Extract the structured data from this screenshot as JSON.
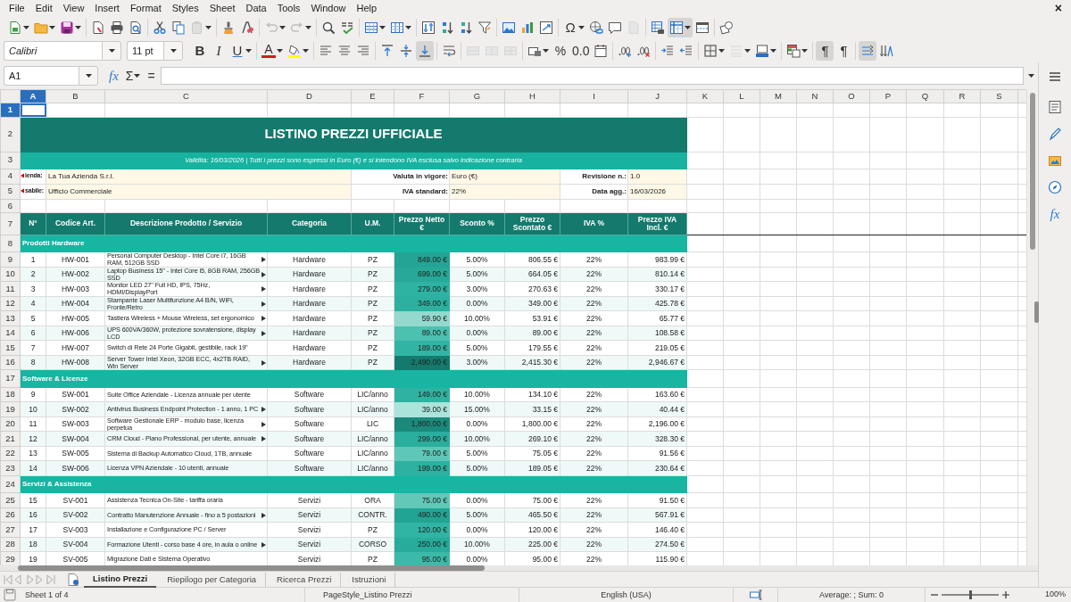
{
  "menu": [
    "File",
    "Edit",
    "View",
    "Insert",
    "Format",
    "Styles",
    "Sheet",
    "Data",
    "Tools",
    "Window",
    "Help"
  ],
  "close_document": "×",
  "standard_toolbar": [
    [
      {
        "kind": "new",
        "dropdown": true,
        "active": false,
        "disabled": false
      },
      {
        "kind": "open",
        "dropdown": true,
        "active": false,
        "disabled": false
      },
      {
        "kind": "save",
        "dropdown": true,
        "active": false,
        "disabled": false
      }
    ],
    [
      {
        "kind": "pdf",
        "dropdown": false,
        "active": false,
        "disabled": false
      },
      {
        "kind": "print",
        "dropdown": false,
        "active": false,
        "disabled": false
      },
      {
        "kind": "preview",
        "dropdown": false,
        "active": false,
        "disabled": false
      }
    ],
    [
      {
        "kind": "cut",
        "dropdown": false,
        "active": false,
        "disabled": false
      },
      {
        "kind": "copy",
        "dropdown": false,
        "active": false,
        "disabled": false
      },
      {
        "kind": "paste",
        "dropdown": true,
        "active": false,
        "disabled": true
      }
    ],
    [
      {
        "kind": "clone",
        "dropdown": false,
        "active": false,
        "disabled": false
      },
      {
        "kind": "clear",
        "dropdown": false,
        "active": false,
        "disabled": false
      }
    ],
    [
      {
        "kind": "undo",
        "dropdown": true,
        "active": false,
        "disabled": true
      },
      {
        "kind": "redo",
        "dropdown": true,
        "active": false,
        "disabled": true
      }
    ],
    [
      {
        "kind": "find",
        "dropdown": false,
        "active": false,
        "disabled": false
      },
      {
        "kind": "spelling",
        "dropdown": false,
        "active": false,
        "disabled": false
      }
    ],
    [
      {
        "kind": "rows",
        "dropdown": true,
        "active": false,
        "disabled": false
      },
      {
        "kind": "columns",
        "dropdown": true,
        "active": false,
        "disabled": false
      }
    ],
    [
      {
        "kind": "sort",
        "dropdown": false,
        "active": false,
        "disabled": false
      },
      {
        "kind": "sort-asc",
        "dropdown": false,
        "active": false,
        "disabled": false
      },
      {
        "kind": "sort-desc",
        "dropdown": false,
        "active": false,
        "disabled": false
      },
      {
        "kind": "filter",
        "dropdown": false,
        "active": false,
        "disabled": false
      }
    ],
    [
      {
        "kind": "image",
        "dropdown": false,
        "active": false,
        "disabled": false
      },
      {
        "kind": "chart",
        "dropdown": false,
        "active": false,
        "disabled": false
      },
      {
        "kind": "pivot",
        "dropdown": false,
        "active": false,
        "disabled": false
      }
    ],
    [
      {
        "kind": "special-character",
        "label": "Ω",
        "dropdown": true,
        "active": false,
        "disabled": false
      },
      {
        "kind": "hyperlink",
        "dropdown": false,
        "active": false,
        "disabled": false
      },
      {
        "kind": "comment",
        "dropdown": false,
        "active": false,
        "disabled": false
      },
      {
        "kind": "header-footer",
        "dropdown": false,
        "active": false,
        "disabled": true
      }
    ],
    [
      {
        "kind": "print-area",
        "dropdown": false,
        "active": false,
        "disabled": false
      },
      {
        "kind": "freeze",
        "dropdown": true,
        "active": true,
        "disabled": false
      },
      {
        "kind": "split",
        "dropdown": false,
        "active": false,
        "disabled": false
      }
    ],
    [
      {
        "kind": "shapes",
        "dropdown": false,
        "active": false,
        "disabled": false
      }
    ]
  ],
  "font_name": {
    "value": "Calibri"
  },
  "font_size": {
    "value": "11 pt"
  },
  "formatting_toolbar": [
    [
      {
        "kind": "bold",
        "label": "B",
        "dropdown": false,
        "active": false,
        "disabled": false
      },
      {
        "kind": "italic",
        "label": "I",
        "dropdown": false,
        "active": false,
        "disabled": false
      },
      {
        "kind": "underline",
        "label": "U",
        "dropdown": true,
        "active": false,
        "disabled": false
      }
    ],
    [
      {
        "kind": "font-color",
        "label": "A",
        "color": "#c9211e",
        "dropdown": true,
        "active": false,
        "disabled": false
      },
      {
        "kind": "highlight",
        "color": "#ffff00",
        "dropdown": true,
        "active": false,
        "disabled": false
      }
    ],
    [
      {
        "kind": "align-left",
        "dropdown": false,
        "active": false,
        "disabled": false
      },
      {
        "kind": "align-center",
        "dropdown": false,
        "active": false,
        "disabled": false
      },
      {
        "kind": "align-right",
        "dropdown": false,
        "active": false,
        "disabled": false
      }
    ],
    [
      {
        "kind": "align-top",
        "dropdown": false,
        "active": false,
        "disabled": false
      },
      {
        "kind": "align-middle",
        "dropdown": false,
        "active": false,
        "disabled": false
      },
      {
        "kind": "align-bottom",
        "dropdown": false,
        "active": true,
        "disabled": false
      }
    ],
    [
      {
        "kind": "wrap",
        "dropdown": false,
        "active": false,
        "disabled": false
      }
    ],
    [
      {
        "kind": "merge-center",
        "dropdown": false,
        "active": false,
        "disabled": true
      },
      {
        "kind": "merge",
        "dropdown": false,
        "active": false,
        "disabled": true
      },
      {
        "kind": "unmerge",
        "dropdown": false,
        "active": false,
        "disabled": true
      }
    ],
    [
      {
        "kind": "currency",
        "dropdown": true,
        "active": false,
        "disabled": false
      },
      {
        "kind": "percent",
        "label": "%",
        "dropdown": false,
        "active": false,
        "disabled": false
      },
      {
        "kind": "number",
        "label": "0.0",
        "dropdown": false,
        "active": false,
        "disabled": false
      },
      {
        "kind": "date",
        "dropdown": false,
        "active": false,
        "disabled": false
      }
    ],
    [
      {
        "kind": "add-decimal",
        "dropdown": false,
        "active": false,
        "disabled": false
      },
      {
        "kind": "delete-decimal",
        "dropdown": false,
        "active": false,
        "disabled": false
      }
    ],
    [
      {
        "kind": "indent",
        "dropdown": false,
        "active": false,
        "disabled": false
      },
      {
        "kind": "outdent",
        "dropdown": false,
        "active": false,
        "disabled": false
      }
    ],
    [
      {
        "kind": "borders",
        "dropdown": true,
        "active": false,
        "disabled": false
      },
      {
        "kind": "border-style",
        "dropdown": true,
        "active": false,
        "disabled": true
      },
      {
        "kind": "border-color",
        "dropdown": true,
        "active": false,
        "disabled": false
      }
    ],
    [
      {
        "kind": "conditional",
        "dropdown": true,
        "active": false,
        "disabled": false
      }
    ],
    [
      {
        "kind": "ltr",
        "label": "¶",
        "dropdown": false,
        "active": true,
        "disabled": false
      },
      {
        "kind": "rtl",
        "label": "¶",
        "dropdown": false,
        "active": false,
        "disabled": false
      }
    ],
    [
      {
        "kind": "text-direction",
        "dropdown": false,
        "active": true,
        "disabled": false
      },
      {
        "kind": "vertical-text",
        "dropdown": false,
        "active": false,
        "disabled": false
      }
    ]
  ],
  "formula_bar": {
    "name_box": "A1",
    "function_wizard": "fx",
    "sum": "Σ",
    "equals": "="
  },
  "sheet": {
    "columns": [
      {
        "label": "A",
        "selected": true
      },
      {
        "label": "B",
        "selected": false
      },
      {
        "label": "C",
        "selected": false
      },
      {
        "label": "D",
        "selected": false
      },
      {
        "label": "E",
        "selected": false
      },
      {
        "label": "F",
        "selected": false
      },
      {
        "label": "G",
        "selected": false
      },
      {
        "label": "H",
        "selected": false
      },
      {
        "label": "I",
        "selected": false
      },
      {
        "label": "J",
        "selected": false
      },
      {
        "label": "K",
        "selected": false
      },
      {
        "label": "L",
        "selected": false
      },
      {
        "label": "M",
        "selected": false
      },
      {
        "label": "N",
        "selected": false
      },
      {
        "label": "O",
        "selected": false
      },
      {
        "label": "P",
        "selected": false
      },
      {
        "label": "Q",
        "selected": false
      },
      {
        "label": "R",
        "selected": false
      },
      {
        "label": "S",
        "selected": false
      }
    ],
    "rows": [
      {
        "number": "1",
        "selected": true,
        "kind": "blank"
      },
      {
        "number": "2",
        "selected": false,
        "kind": "title",
        "text": "LISTINO PREZZI UFFICIALE"
      },
      {
        "number": "3",
        "selected": false,
        "kind": "subtitle",
        "text": "Validità: 16/03/2026  |  Tutti i prezzi sono espressi in Euro (€) e si intendono IVA esclusa salvo indicazione contraria"
      },
      {
        "number": "4",
        "selected": false,
        "kind": "info",
        "cells": [
          {
            "label": "ienda:",
            "overflow": true,
            "value": "La Tua Azienda S.r.l."
          },
          {
            "label": "Valuta in vigore:",
            "overflow": false,
            "value": "Euro (€)"
          },
          {
            "label": "Revisione n.:",
            "overflow": false,
            "value": "1.0"
          }
        ]
      },
      {
        "number": "5",
        "selected": false,
        "kind": "info",
        "cells": [
          {
            "label": "sabile:",
            "overflow": true,
            "value": "Ufficio Commerciale"
          },
          {
            "label": "IVA standard:",
            "overflow": false,
            "value": "22%"
          },
          {
            "label": "Data agg.:",
            "overflow": false,
            "value": "16/03/2026"
          }
        ]
      },
      {
        "number": "6",
        "selected": false,
        "kind": "blank"
      },
      {
        "number": "7",
        "selected": false,
        "kind": "header",
        "cells": [
          "N°",
          "Codice Art.",
          "Descrizione Prodotto / Servizio",
          "Categoria",
          "U.M.",
          "Prezzo Netto €",
          "Sconto %",
          "Prezzo Scontato €",
          "IVA %",
          "Prezzo IVA Incl. €"
        ]
      },
      {
        "number": "8",
        "selected": false,
        "kind": "section",
        "text": "Prodotti Hardware"
      },
      {
        "number": "9",
        "selected": false,
        "kind": "item",
        "n": "1",
        "code": "HW-001",
        "description": "Personal Computer Desktop - Intel Core i7, 16GB RAM, 512GB SSD",
        "overflow": true,
        "category": "Hardware",
        "unit": "PZ",
        "net": "849.00 €",
        "color": "#24a494",
        "discount": "5.00%",
        "discounted": "806.55 €",
        "vat": "22%",
        "gross": "983.99 €"
      },
      {
        "number": "10",
        "selected": false,
        "kind": "item",
        "n": "2",
        "code": "HW-002",
        "description": "Laptop Business 15\" - Intel Core i5, 8GB RAM, 256GB SSD",
        "overflow": true,
        "category": "Hardware",
        "unit": "PZ",
        "net": "699.00 €",
        "color": "#27a898",
        "discount": "5.00%",
        "discounted": "664.05 €",
        "vat": "22%",
        "gross": "810.14 €"
      },
      {
        "number": "11",
        "selected": false,
        "kind": "item",
        "n": "3",
        "code": "HW-003",
        "description": "Monitor LED 27\" Full HD, IPS, 75Hz, HDMI/DisplayPort",
        "overflow": true,
        "category": "Hardware",
        "unit": "PZ",
        "net": "279.00 €",
        "color": "#2eb2a1",
        "discount": "3.00%",
        "discounted": "270.63 €",
        "vat": "22%",
        "gross": "330.17 €"
      },
      {
        "number": "12",
        "selected": false,
        "kind": "item",
        "n": "4",
        "code": "HW-004",
        "description": "Stampante Laser Multifunzione A4 B/N, WiFi, Fronte/Retro",
        "overflow": true,
        "category": "Hardware",
        "unit": "PZ",
        "net": "349.00 €",
        "color": "#2cb09f",
        "discount": "0.00%",
        "discounted": "349.00 €",
        "vat": "22%",
        "gross": "425.78 €"
      },
      {
        "number": "13",
        "selected": false,
        "kind": "item",
        "n": "5",
        "code": "HW-005",
        "description": "Tastiera Wireless + Mouse Wireless, set ergonomico",
        "overflow": true,
        "category": "Hardware",
        "unit": "PZ",
        "net": "59.90 €",
        "color": "#93d9cd",
        "discount": "10.00%",
        "discounted": "53.91 €",
        "vat": "22%",
        "gross": "65.77 €"
      },
      {
        "number": "14",
        "selected": false,
        "kind": "item",
        "n": "6",
        "code": "HW-006",
        "description": "UPS 600VA/360W, protezione sovratensione, display LCD",
        "overflow": true,
        "category": "Hardware",
        "unit": "PZ",
        "net": "89.00 €",
        "color": "#4cc1b0",
        "discount": "0.00%",
        "discounted": "89.00 €",
        "vat": "22%",
        "gross": "108.58 €"
      },
      {
        "number": "15",
        "selected": false,
        "kind": "item",
        "n": "7",
        "code": "HW-007",
        "description": "Switch di Rete 24 Porte Gigabit, gestibile, rack 19\"",
        "overflow": false,
        "category": "Hardware",
        "unit": "PZ",
        "net": "189.00 €",
        "color": "#31b4a3",
        "discount": "5.00%",
        "discounted": "179.55 €",
        "vat": "22%",
        "gross": "219.05 €"
      },
      {
        "number": "16",
        "selected": false,
        "kind": "item",
        "n": "8",
        "code": "HW-008",
        "description": "Server Tower Intel Xeon, 32GB ECC, 4x2TB RAID, Win Server",
        "overflow": true,
        "category": "Hardware",
        "unit": "PZ",
        "net": "2,490.00 €",
        "color": "#137a6d",
        "discount": "3.00%",
        "discounted": "2,415.30 €",
        "vat": "22%",
        "gross": "2,946.67 €"
      },
      {
        "number": "17",
        "selected": false,
        "kind": "section",
        "text": "Software & Licenze"
      },
      {
        "number": "18",
        "selected": false,
        "kind": "item",
        "n": "9",
        "code": "SW-001",
        "description": "Suite Office Aziendale - Licenza annuale per utente",
        "overflow": false,
        "category": "Software",
        "unit": "LIC/anno",
        "net": "149.00 €",
        "color": "#2fb2a1",
        "discount": "10.00%",
        "discounted": "134.10 €",
        "vat": "22%",
        "gross": "163.60 €"
      },
      {
        "number": "19",
        "selected": false,
        "kind": "item",
        "n": "10",
        "code": "SW-002",
        "description": "Antivirus Business Endpoint Protection - 1 anno, 1 PC",
        "overflow": true,
        "category": "Software",
        "unit": "LIC/anno",
        "net": "39.00 €",
        "color": "#abe4da",
        "discount": "15.00%",
        "discounted": "33.15 €",
        "vat": "22%",
        "gross": "40.44 €"
      },
      {
        "number": "20",
        "selected": false,
        "kind": "item",
        "n": "11",
        "code": "SW-003",
        "description": "Software Gestionale ERP - modulo base, licenza perpetua",
        "overflow": true,
        "category": "Software",
        "unit": "LIC",
        "net": "1,800.00 €",
        "color": "#1b8a7c",
        "discount": "0.00%",
        "discounted": "1,800.00 €",
        "vat": "22%",
        "gross": "2,196.00 €"
      },
      {
        "number": "21",
        "selected": false,
        "kind": "item",
        "n": "12",
        "code": "SW-004",
        "description": "CRM Cloud - Piano Professional, per utente, annuale",
        "overflow": true,
        "category": "Software",
        "unit": "LIC/anno",
        "net": "299.00 €",
        "color": "#2aae9d",
        "discount": "10.00%",
        "discounted": "269.10 €",
        "vat": "22%",
        "gross": "328.30 €"
      },
      {
        "number": "22",
        "selected": false,
        "kind": "item",
        "n": "13",
        "code": "SW-005",
        "description": "Sistema di Backup Automatico Cloud, 1TB, annuale",
        "overflow": false,
        "category": "Software",
        "unit": "LIC/anno",
        "net": "79.00 €",
        "color": "#5ec7b7",
        "discount": "5.00%",
        "discounted": "75.05 €",
        "vat": "22%",
        "gross": "91.56 €"
      },
      {
        "number": "23",
        "selected": false,
        "kind": "item",
        "n": "14",
        "code": "SW-006",
        "description": "Licenza VPN Aziendale - 10 utenti, annuale",
        "overflow": false,
        "category": "Software",
        "unit": "LIC/anno",
        "net": "199.00 €",
        "color": "#2db1a0",
        "discount": "5.00%",
        "discounted": "189.05 €",
        "vat": "22%",
        "gross": "230.64 €"
      },
      {
        "number": "24",
        "selected": false,
        "kind": "section",
        "text": "Servizi & Assistenza"
      },
      {
        "number": "25",
        "selected": false,
        "kind": "item",
        "n": "15",
        "code": "SV-001",
        "description": "Assistenza Tecnica On-Site - tariffa oraria",
        "overflow": false,
        "category": "Servizi",
        "unit": "ORA",
        "net": "75.00 €",
        "color": "#62c8b8",
        "discount": "0.00%",
        "discounted": "75.00 €",
        "vat": "22%",
        "gross": "91.50 €"
      },
      {
        "number": "26",
        "selected": false,
        "kind": "item",
        "n": "16",
        "code": "SV-002",
        "description": "Contratto Manutenzione Annuale - fino a 5 postazioni",
        "overflow": true,
        "category": "Servizi",
        "unit": "CONTR.",
        "net": "490.00 €",
        "color": "#22a493",
        "discount": "5.00%",
        "discounted": "465.50 €",
        "vat": "22%",
        "gross": "567.91 €"
      },
      {
        "number": "27",
        "selected": false,
        "kind": "item",
        "n": "17",
        "code": "SV-003",
        "description": "Installazione e Configurazione PC / Server",
        "overflow": false,
        "category": "Servizi",
        "unit": "PZ",
        "net": "120.00 €",
        "color": "#30b4a3",
        "discount": "0.00%",
        "discounted": "120.00 €",
        "vat": "22%",
        "gross": "146.40 €"
      },
      {
        "number": "28",
        "selected": false,
        "kind": "item",
        "n": "18",
        "code": "SV-004",
        "description": "Formazione Utenti - corso base 4 ore, in aula o online",
        "overflow": true,
        "category": "Servizi",
        "unit": "CORSO",
        "net": "250.00 €",
        "color": "#27ab9a",
        "discount": "10.00%",
        "discounted": "225.00 €",
        "vat": "22%",
        "gross": "274.50 €"
      },
      {
        "number": "29",
        "selected": false,
        "kind": "item",
        "n": "19",
        "code": "SV-005",
        "description": "Migrazione Dati e Sistema Operativo",
        "overflow": false,
        "category": "Servizi",
        "unit": "PZ",
        "net": "95.00 €",
        "color": "#3cbaa9",
        "discount": "0.00%",
        "discounted": "95.00 €",
        "vat": "22%",
        "gross": "115.90 €"
      }
    ]
  },
  "sheet_tabs": [
    {
      "label": "Listino Prezzi",
      "selected": true
    },
    {
      "label": "Riepilogo per Categoria",
      "selected": false
    },
    {
      "label": "Ricerca Prezzi",
      "selected": false
    },
    {
      "label": "Istruzioni",
      "selected": false
    }
  ],
  "sidebar": {
    "functions": "fx"
  },
  "status_bar": {
    "sheet_position": "Sheet 1 of 4",
    "page_style": "PageStyle_Listino Prezzi",
    "language": "English (USA)",
    "selection_summary": "Average: ; Sum: 0",
    "zoom": {
      "level": 0.5,
      "reading": "100%"
    }
  }
}
